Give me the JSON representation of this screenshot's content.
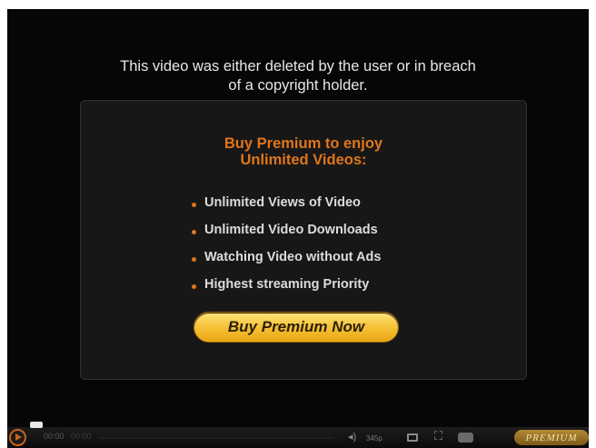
{
  "player": {
    "message_line1": "This video was either deleted by the user or in breach",
    "message_line2": "of a copyright holder.",
    "promo": {
      "title_line1": "Buy Premium to enjoy",
      "title_line2": "Unlimited Videos:",
      "features": [
        "Unlimited Views of Video",
        "Unlimited Video Downloads",
        "Watching Video without Ads",
        "Highest streaming Priority"
      ],
      "button_label": "Buy Premium Now"
    },
    "controls": {
      "time_current": "00:00",
      "time_total": "00:00",
      "quality": "345p",
      "badge": "PREMIUM"
    }
  },
  "colors": {
    "accent_orange": "#e0751b",
    "button_gold": "#f6c237",
    "background": "#060606",
    "panel": "#171717"
  },
  "icons": [
    "play-icon",
    "volume-icon",
    "screen-icon",
    "fullscreen-icon",
    "caption-icon"
  ]
}
